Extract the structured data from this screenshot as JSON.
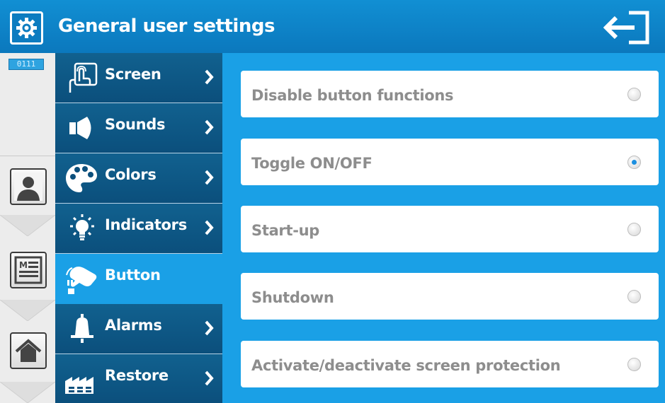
{
  "header": {
    "title": "General user settings",
    "icon": "gear-icon",
    "exit_icon": "exit-icon"
  },
  "rail": {
    "counter": "0111",
    "buttons": [
      {
        "icon": "user-profile-icon"
      },
      {
        "icon": "menu-list-icon"
      },
      {
        "icon": "home-icon"
      }
    ]
  },
  "menu": {
    "items": [
      {
        "label": "Screen",
        "icon": "touch-screen-icon",
        "active": false
      },
      {
        "label": "Sounds",
        "icon": "speaker-icon",
        "active": false
      },
      {
        "label": "Colors",
        "icon": "palette-icon",
        "active": false
      },
      {
        "label": "Indicators",
        "icon": "lightbulb-icon",
        "active": false
      },
      {
        "label": "Button",
        "icon": "hand-press-icon",
        "active": true
      },
      {
        "label": "Alarms",
        "icon": "bell-icon",
        "active": false
      },
      {
        "label": "Restore",
        "icon": "factory-icon",
        "active": false
      }
    ]
  },
  "options": [
    {
      "label": "Disable button functions",
      "checked": false
    },
    {
      "label": "Toggle ON/OFF",
      "checked": true
    },
    {
      "label": "Start-up",
      "checked": false
    },
    {
      "label": "Shutdown",
      "checked": false
    },
    {
      "label": "Activate/deactivate screen protection",
      "checked": false
    }
  ],
  "colors": {
    "accent": "#1aa0e6",
    "menu_bg": "#0c5180",
    "header_bg": "#0b78bd",
    "radio_selected": "#1c8fe0"
  }
}
